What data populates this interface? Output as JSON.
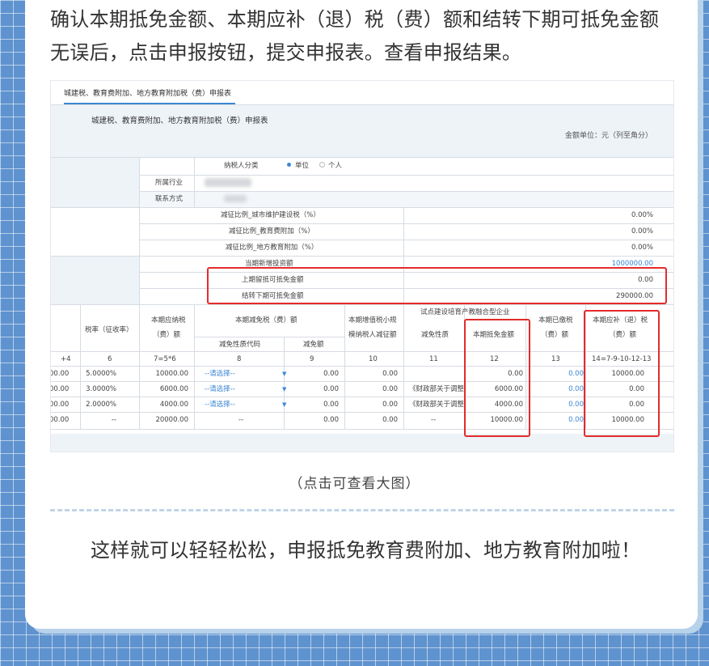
{
  "para1": "确认本期抵免金额、本期应补（退）税（费）额和结转下期可抵免金额无误后，点击申报按钮，提交申报表。查看申报结果。",
  "shot": {
    "tab": "城建税、教育费附加、地方教育附加税（费）申报表",
    "form_title": "城建税、教育费附加、地方教育附加税（费）申报表",
    "unit": "金额单位：元（列至角分）",
    "taxpayer_type_label": "纳税人分类",
    "taxpayer_opt1": "单位",
    "taxpayer_opt2": "个人",
    "industry_label": "所属行业",
    "contact_label": "联系方式",
    "reduce_rows": [
      {
        "label": "减征比例_城市维护建设税（%）",
        "value": "0.00%"
      },
      {
        "label": "减征比例_教育费附加（%）",
        "value": "0.00%"
      },
      {
        "label": "减征比例_地方教育附加（%）",
        "value": "0.00%"
      }
    ],
    "credit_rows": [
      {
        "label": "当期新增投资额",
        "value": "1000000.00"
      },
      {
        "label": "上期留抵可抵免金额",
        "value": "0.00"
      },
      {
        "label": "结转下期可抵免金额",
        "value": "290000.00"
      }
    ],
    "headers": {
      "tax_rate": "税率（征收率）",
      "payable1": "本期应纳税",
      "payable2": "（费）额",
      "reduction": "本期减免税（费）额",
      "reduce_code": "减免性质代码",
      "reduce_amt": "减免额",
      "small_scale1": "本期增值税小规",
      "small_scale2": "模纳税人减征额",
      "pilot": "试点建设培育产教融合型企业",
      "reduce_nature": "减免性质",
      "credit_amt": "本期抵免金额",
      "paid1": "本期已缴税",
      "paid2": "（费）额",
      "refund1": "本期应补（退）税",
      "refund2": "（费）额"
    },
    "col_numbers": [
      "+4",
      "6",
      "7=5*6",
      "8",
      "9",
      "10",
      "11",
      "12",
      "13",
      "14=7-9-10-12-13"
    ],
    "rows": [
      {
        "c0": "00.00",
        "rate": "5.0000%",
        "payable": "10000.00",
        "code": "--请选择--",
        "amt": "0.00",
        "small": "0.00",
        "nature": "",
        "credit": "0.00",
        "paid": "0.00",
        "refund": "10000.00"
      },
      {
        "c0": "00.00",
        "rate": "3.0000%",
        "payable": "6000.00",
        "code": "--请选择--",
        "amt": "0.00",
        "small": "0.00",
        "nature": "《财政部关于调整",
        "credit": "6000.00",
        "paid": "0.00",
        "refund": "0.00"
      },
      {
        "c0": "00.00",
        "rate": "2.0000%",
        "payable": "4000.00",
        "code": "--请选择--",
        "amt": "0.00",
        "small": "0.00",
        "nature": "《财政部关于调整",
        "credit": "4000.00",
        "paid": "0.00",
        "refund": "0.00"
      },
      {
        "c0": "00.00",
        "rate": "--",
        "payable": "20000.00",
        "code": "--",
        "amt": "0.00",
        "small": "0.00",
        "nature": "--",
        "credit": "10000.00",
        "paid": "0.00",
        "refund": "10000.00"
      }
    ]
  },
  "caption": "（点击可查看大图）",
  "para2": "这样就可以轻轻松松，申报抵免教育费附加、地方教育附加啦！",
  "colors": {
    "background": "#5f93cf",
    "highlight": "#e42b2b",
    "link": "#3c87d3"
  }
}
